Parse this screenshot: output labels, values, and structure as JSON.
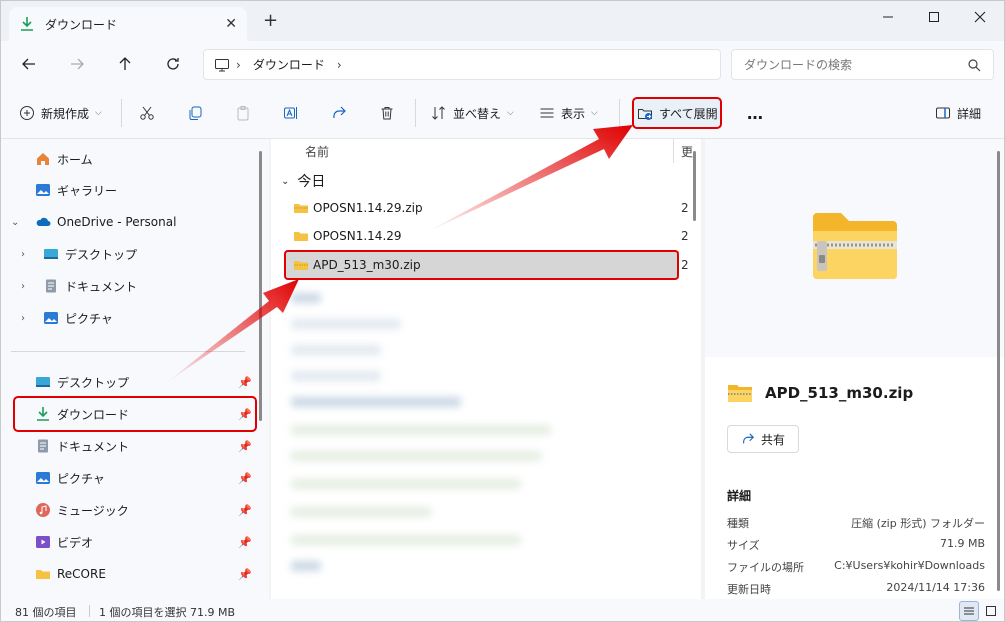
{
  "titlebar": {
    "tab_label": "ダウンロード",
    "new_tab": "+"
  },
  "address": {
    "crumbs": [
      "ダウンロード"
    ],
    "search_placeholder": "ダウンロードの検索"
  },
  "commandbar": {
    "new_label": "新規作成",
    "sort_label": "並べ替え",
    "view_label": "表示",
    "expand_all_label": "すべて展開",
    "more_label": "…",
    "details_label": "詳細"
  },
  "nav": {
    "home": "ホーム",
    "gallery": "ギャラリー",
    "onedrive": "OneDrive - Personal",
    "od_desktop": "デスクトップ",
    "od_documents": "ドキュメント",
    "od_pictures": "ピクチャ",
    "pinned": [
      {
        "label": "デスクトップ"
      },
      {
        "label": "ダウンロード"
      },
      {
        "label": "ドキュメント"
      },
      {
        "label": "ピクチャ"
      },
      {
        "label": "ミュージック"
      },
      {
        "label": "ビデオ"
      },
      {
        "label": "ReCORE"
      }
    ]
  },
  "filelist": {
    "col_name": "名前",
    "col_date": "更",
    "group": "今日",
    "rows": [
      {
        "name": "OPOSN1.14.29.zip",
        "date": "2"
      },
      {
        "name": "OPOSN1.14.29",
        "date": "2"
      },
      {
        "name": "APD_513_m30.zip",
        "date": "2"
      }
    ]
  },
  "details": {
    "title": "APD_513_m30.zip",
    "share_label": "共有",
    "section": "詳細",
    "props": [
      {
        "k": "種類",
        "v": "圧縮 (zip 形式) フォルダー"
      },
      {
        "k": "サイズ",
        "v": "71.9 MB"
      },
      {
        "k": "ファイルの場所",
        "v": "C:¥Users¥kohir¥Downloads"
      },
      {
        "k": "更新日時",
        "v": "2024/11/14 17:36"
      }
    ]
  },
  "status": {
    "count": "81 個の項目",
    "selection": "1 個の項目を選択  71.9 MB"
  },
  "colors": {
    "highlight": "#e00000",
    "accent": "#0067c0",
    "folder": "#f5c242"
  }
}
